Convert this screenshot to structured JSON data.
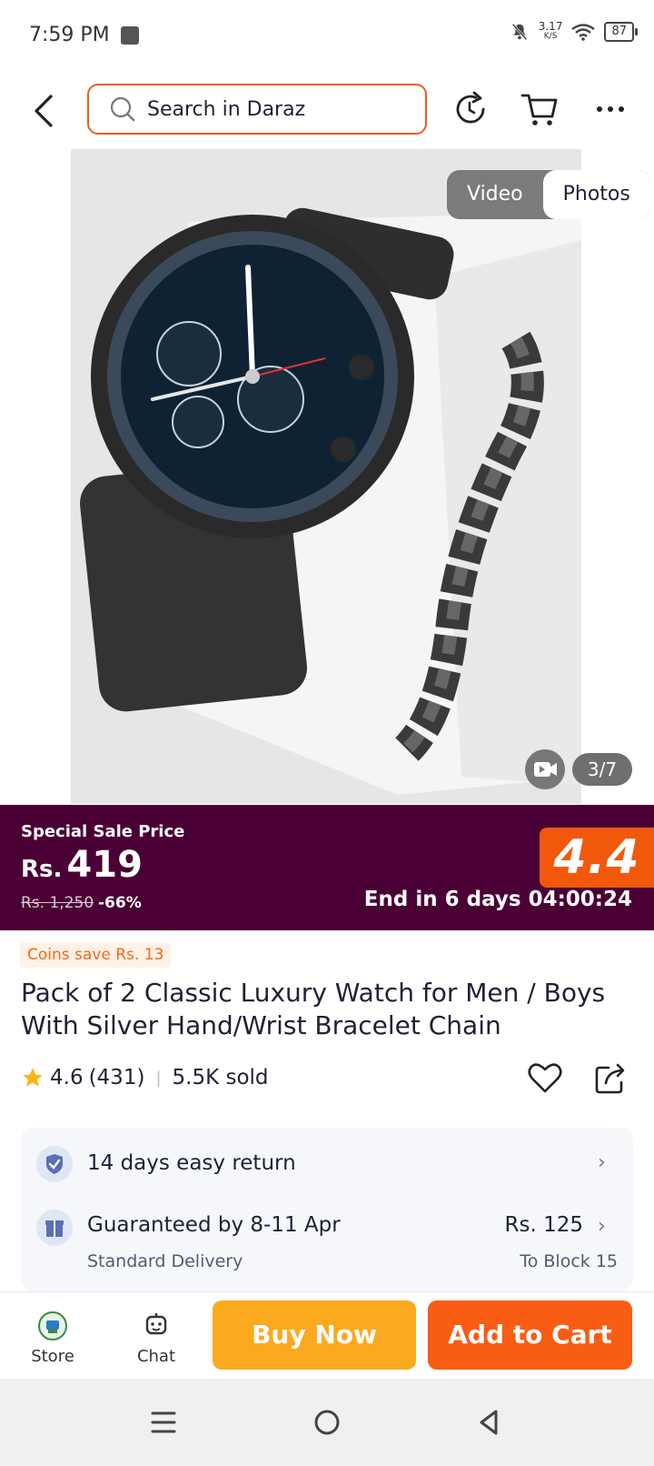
{
  "status_bar": {
    "time": "7:59 PM",
    "speed_value": "3.17",
    "speed_unit": "K/S",
    "battery": "87"
  },
  "header": {
    "search_placeholder": "Search in Daraz"
  },
  "gallery": {
    "tabs": [
      {
        "label": "Video",
        "active": false
      },
      {
        "label": "Photos",
        "active": true
      }
    ],
    "counter": "3/7"
  },
  "price": {
    "special_label": "Special Sale Price",
    "currency": "Rs.",
    "current": "419",
    "original": "Rs. 1,250",
    "discount": "-66%",
    "campaign_badge": "4.4",
    "countdown": "End in 6 days 04:00:24"
  },
  "product": {
    "coins_badge": "Coins save Rs. 13",
    "title": "Pack of 2 Classic Luxury Watch for Men / Boys With Silver Hand/Wrist Bracelet Chain",
    "rating": "4.6",
    "reviews": "(431)",
    "sold": "5.5K sold"
  },
  "services": {
    "return_policy": "14 days easy return",
    "guarantee": "Guaranteed by 8-11 Apr",
    "delivery_type": "Standard Delivery",
    "delivery_fee": "Rs. 125",
    "delivery_location": "To Block 15"
  },
  "bottom_bar": {
    "store_label": "Store",
    "chat_label": "Chat",
    "buy_now": "Buy Now",
    "add_to_cart": "Add to Cart"
  },
  "colors": {
    "accent": "#f95d14",
    "buy_now": "#fbaa1f",
    "price_band": "#4a0035",
    "search_border": "#f05a1f"
  }
}
